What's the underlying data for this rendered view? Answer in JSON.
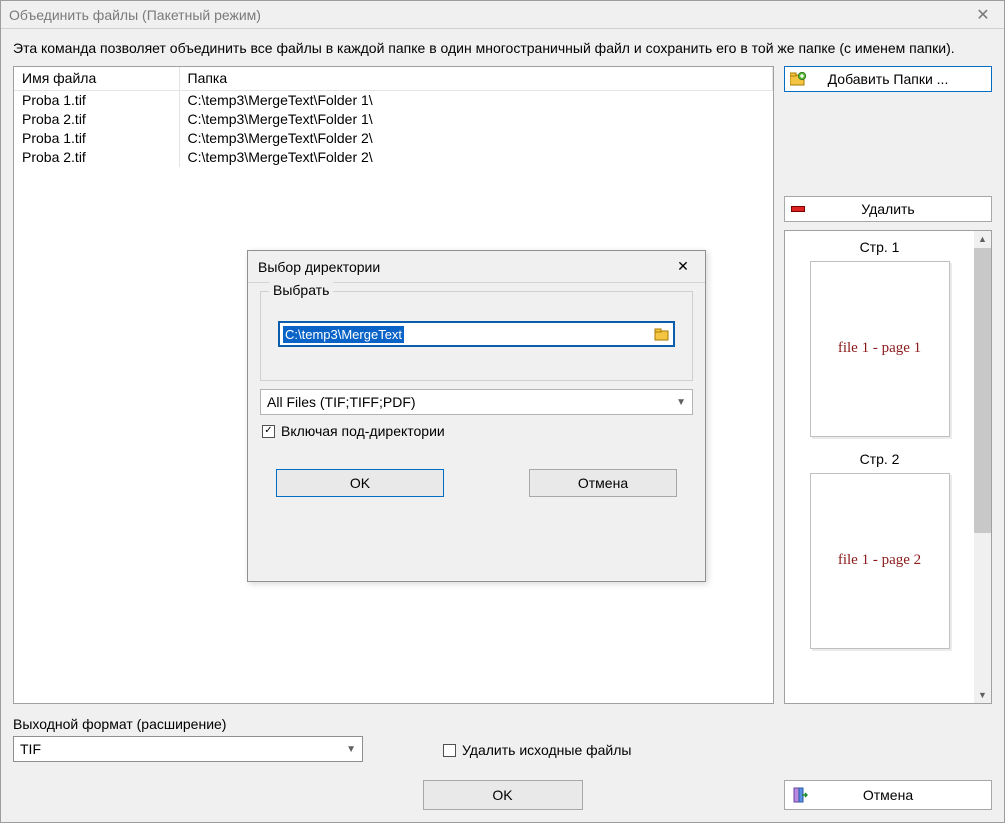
{
  "window": {
    "title": "Объединить файлы (Пакетный режим)"
  },
  "description": "Эта команда позволяет объединить все файлы в каждой папке в один многостраничный файл и сохранить его в той же папке (с именем папки).",
  "filelist": {
    "headers": {
      "name": "Имя файла",
      "folder": "Папка"
    },
    "rows": [
      {
        "name": "Proba 1.tif",
        "folder": "C:\\temp3\\MergeText\\Folder 1\\"
      },
      {
        "name": "Proba 2.tif",
        "folder": "C:\\temp3\\MergeText\\Folder 1\\"
      },
      {
        "name": "Proba 1.tif",
        "folder": "C:\\temp3\\MergeText\\Folder 2\\"
      },
      {
        "name": "Proba 2.tif",
        "folder": "C:\\temp3\\MergeText\\Folder 2\\"
      }
    ]
  },
  "sidebar": {
    "add_folders_label": "Добавить Папки ...",
    "delete_label": "Удалить"
  },
  "preview": {
    "items": [
      {
        "label": "Стр. 1",
        "content": "file 1 - page 1"
      },
      {
        "label": "Стр. 2",
        "content": "file 1 - page 2"
      }
    ]
  },
  "output": {
    "format_label": "Выходной формат (расширение)",
    "format_value": "TIF",
    "delete_sources_label": "Удалить исходные файлы",
    "delete_sources_checked": false,
    "ok_label": "OK",
    "cancel_label": "Отмена"
  },
  "modal": {
    "title": "Выбор директории",
    "group_label": "Выбрать",
    "path_value": "C:\\temp3\\MergeText",
    "filter_value": "All Files (TIF;TIFF;PDF)",
    "include_subdirs_label": "Включая под-директории",
    "include_subdirs_checked": true,
    "ok_label": "OK",
    "cancel_label": "Отмена"
  }
}
